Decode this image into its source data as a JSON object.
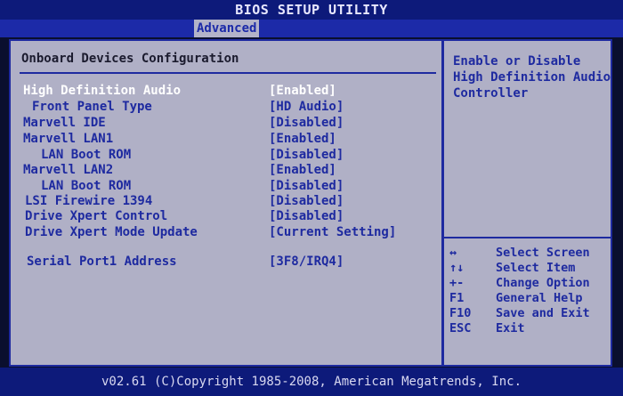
{
  "app_title": "BIOS SETUP UTILITY",
  "active_tab": "Advanced",
  "section_title": "Onboard Devices Configuration",
  "settings": [
    {
      "label": "High Definition Audio",
      "value": "[Enabled]"
    },
    {
      "label": "Front Panel Type",
      "value": "[HD Audio]"
    },
    {
      "label": "Marvell IDE",
      "value": "[Disabled]"
    },
    {
      "label": "Marvell LAN1",
      "value": "[Enabled]"
    },
    {
      "label": "LAN Boot ROM",
      "value": "[Disabled]"
    },
    {
      "label": "Marvell LAN2",
      "value": "[Enabled]"
    },
    {
      "label": "LAN Boot ROM",
      "value": "[Disabled]"
    },
    {
      "label": "LSI Firewire 1394",
      "value": "[Disabled]"
    },
    {
      "label": "Drive Xpert Control",
      "value": "[Disabled]"
    },
    {
      "label": "Drive Xpert Mode Update",
      "value": "[Current Setting]"
    },
    {
      "label": "Serial Port1 Address",
      "value": "[3F8/IRQ4]"
    }
  ],
  "help_text": "Enable or Disable\nHigh Definition Audio\nController",
  "keys": [
    {
      "key": "↔",
      "action": "Select Screen"
    },
    {
      "key": "↑↓",
      "action": "Select Item"
    },
    {
      "key": "+-",
      "action": "Change Option"
    },
    {
      "key": "F1",
      "action": "General Help"
    },
    {
      "key": "F10",
      "action": "Save and Exit"
    },
    {
      "key": "ESC",
      "action": "Exit"
    }
  ],
  "footer": "v02.61 (C)Copyright 1985-2008, American Megatrends, Inc.",
  "colors": {
    "title_bar": "#0d1a7a",
    "panel": "#b0b0c6",
    "text": "#1e2aa0",
    "selected_text": "#ffffff"
  }
}
